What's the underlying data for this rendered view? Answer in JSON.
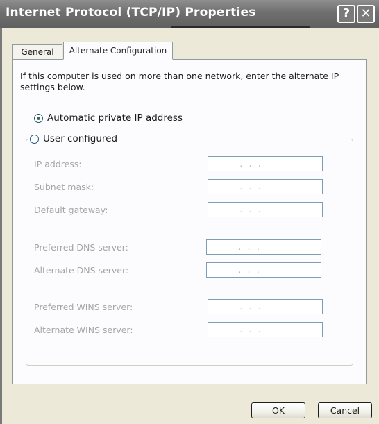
{
  "window": {
    "title": "Internet Protocol (TCP/IP) Properties",
    "help_glyph": "?",
    "close_glyph": "✕"
  },
  "tabs": [
    {
      "label": "General",
      "selected": false
    },
    {
      "label": "Alternate Configuration",
      "selected": true
    }
  ],
  "panel": {
    "intro": "If this computer is used on more than one network, enter the alternate IP settings below.",
    "options": {
      "automatic": {
        "label": "Automatic private IP address",
        "checked": true
      },
      "user": {
        "label": "User configured",
        "checked": false
      }
    },
    "fields": [
      {
        "label": "IP address:",
        "value": ". . ."
      },
      {
        "label": "Subnet mask:",
        "value": ". . ."
      },
      {
        "label": "Default gateway:",
        "value": ". . ."
      },
      {
        "label": "Preferred DNS server:",
        "value": ". . ."
      },
      {
        "label": "Alternate DNS server:",
        "value": ". . ."
      },
      {
        "label": "Preferred WINS server:",
        "value": ". . ."
      },
      {
        "label": "Alternate WINS server:",
        "value": ". . ."
      }
    ]
  },
  "buttons": {
    "ok": "OK",
    "cancel": "Cancel"
  }
}
